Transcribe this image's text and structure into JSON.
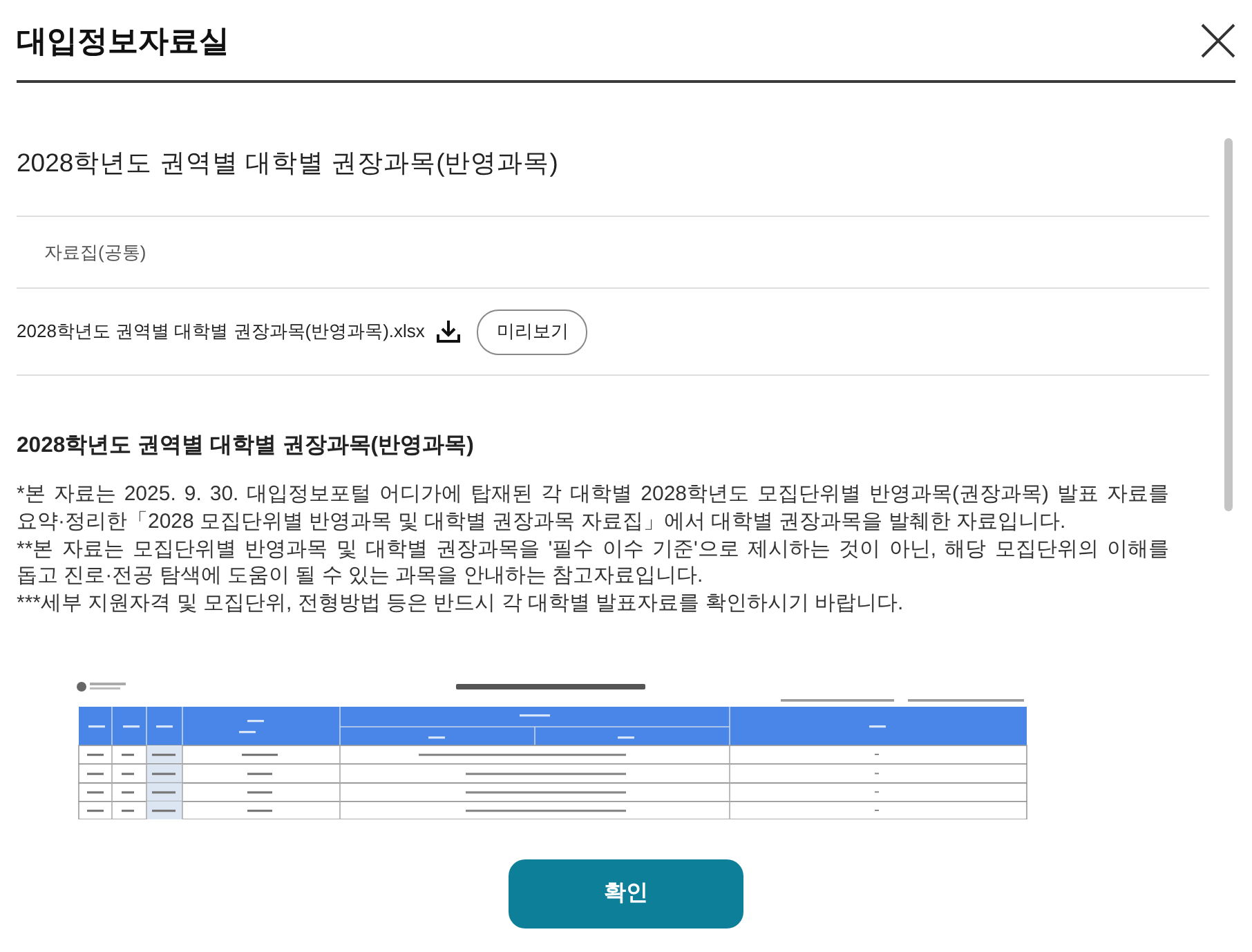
{
  "dialog": {
    "title": "대입정보자료실"
  },
  "section": {
    "title": "2028학년도 권역별 대학별 권장과목(반영과목)",
    "category": "자료집(공통)",
    "files": [
      {
        "name": "2028학년도 권역별 대학별 권장과목(반영과목).xlsx",
        "preview_button": "미리보기"
      }
    ]
  },
  "description": {
    "heading": "2028학년도 권역별 대학별 권장과목(반영과목)",
    "paragraphs": [
      "*본 자료는 2025. 9. 30. 대입정보포털 어디가에 탑재된 각 대학별 2028학년도 모집단위별 반영과목(권장과목) 발표 자료를 요약·정리한「2028 모집단위별 반영과목 및 대학별 권장과목 자료집」에서 대학별 권장과목을 발췌한 자료입니다.",
      "**본 자료는 모집단위별 반영과목 및 대학별 권장과목을 '필수 이수 기준'으로 제시하는 것이 아닌, 해당 모집단위의 이해를 돕고 진로·전공 탐색에 도움이 될 수 있는 과목을 안내하는 참고자료입니다.",
      "***세부 지원자격 및 모집단위, 전형방법 등은 반드시 각 대학별 발표자료를 확인하시기 바랍니다."
    ]
  },
  "footer": {
    "confirm_button": "확인"
  }
}
